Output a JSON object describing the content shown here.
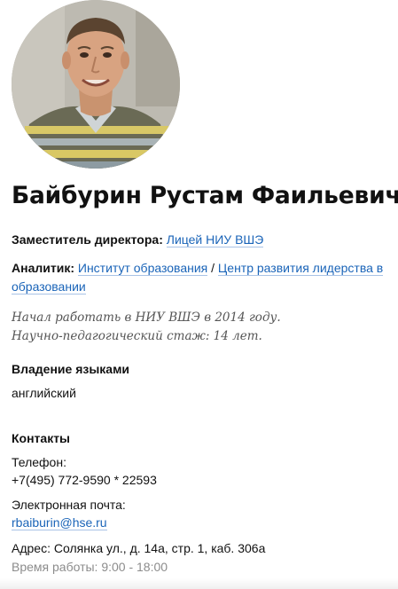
{
  "profile": {
    "full_name": "Байбурин Рустам Фаильевич",
    "avatar_icon": "person-photo"
  },
  "positions": [
    {
      "role": "Заместитель директора:",
      "org": "Лицей НИУ ВШЭ"
    },
    {
      "role": "Аналитик:",
      "org1": "Институт образования",
      "separator": " / ",
      "org2_part1": "Центр развития лидерства в",
      "org2_part2": "образовании"
    }
  ],
  "experience": {
    "started": "Начал работать в НИУ ВШЭ в 2014 году.",
    "tenure": "Научно-педагогический стаж: 14 лет."
  },
  "languages": {
    "title": "Владение языками",
    "value": "английский"
  },
  "contacts": {
    "title": "Контакты",
    "phone_label": "Телефон:",
    "phone_value": "+7(495) 772-9590 * 22593",
    "email_label": "Электронная почта:",
    "email_value": "rbaiburin@hse.ru",
    "address": "Адрес: Солянка ул., д. 14а, стр. 1, каб. 306а",
    "hours": "Время работы: 9:00 - 18:00"
  },
  "colors": {
    "link": "#1a64b8",
    "text": "#111111",
    "muted": "#8c8c8c"
  }
}
